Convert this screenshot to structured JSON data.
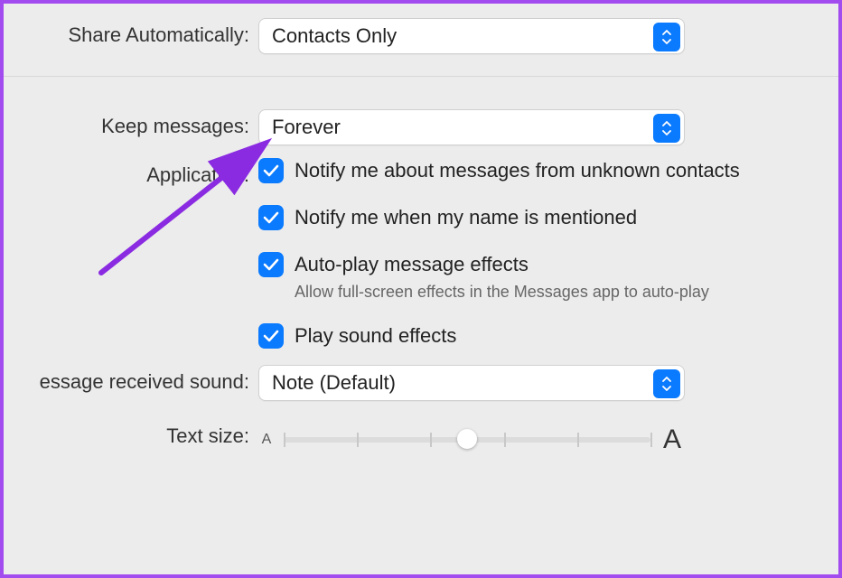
{
  "labels": {
    "share_auto": "Share Automatically:",
    "keep_messages": "Keep messages:",
    "application": "Application:",
    "received_sound": "essage received sound:",
    "text_size": "Text size:"
  },
  "selects": {
    "share_auto_value": "Contacts Only",
    "keep_messages_value": "Forever",
    "received_sound_value": "Note (Default)"
  },
  "checks": {
    "unknown_contacts": "Notify me about messages from unknown contacts",
    "name_mentioned": "Notify me when my name is mentioned",
    "autoplay_effects": "Auto-play message effects",
    "autoplay_help": "Allow full-screen effects in the Messages app to auto-play",
    "sound_effects": "Play sound effects"
  },
  "slider": {
    "small_a": "A",
    "big_a": "A",
    "thumb_percent": 50,
    "ticks": [
      0,
      20,
      40,
      60,
      80,
      100
    ]
  }
}
